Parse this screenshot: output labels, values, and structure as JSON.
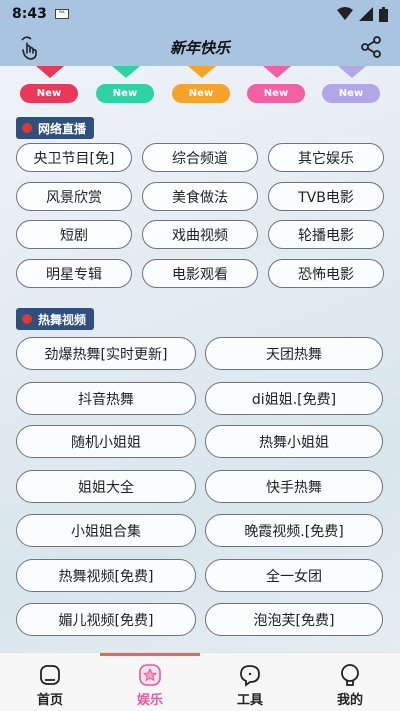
{
  "status": {
    "time": "8:43",
    "mini_icon": "ᴮᴬ"
  },
  "header": {
    "title": "新年快乐"
  },
  "colors": {
    "header": "#a8c4e0",
    "section": "#2f4f7f",
    "accent_pink": "#e05ba0",
    "indicator": "#e3685a"
  },
  "tabs": [
    {
      "label": "New",
      "color": "#e8395b"
    },
    {
      "label": "New",
      "color": "#2ed3a4"
    },
    {
      "label": "New",
      "color": "#f7a229"
    },
    {
      "label": "New",
      "color": "#f25fa2"
    },
    {
      "label": "New",
      "color": "#b3a6e6"
    }
  ],
  "section1": {
    "title": "网络直播",
    "items": [
      "央卫节目[免]",
      "综合频道",
      "其它娱乐",
      "风景欣赏",
      "美食做法",
      "TVB电影",
      "短剧",
      "戏曲视频",
      "轮播电影",
      "明星专辑",
      "电影观看",
      "恐怖电影"
    ]
  },
  "section2": {
    "title": "热舞视频",
    "items": [
      "劲爆热舞[实时更新]",
      "天团热舞",
      "抖音热舞",
      "di姐姐.[免费]",
      "随机小姐姐",
      "热舞小姐姐",
      "姐姐大全",
      "快手热舞",
      "小姐姐合集",
      "晚霞视频.[免费]",
      "热舞视频[免费]",
      "全一女团",
      "媚儿视频[免费]",
      "泡泡芙[免费]"
    ]
  },
  "nav": [
    {
      "label": "首页",
      "icon": "home-icon"
    },
    {
      "label": "娱乐",
      "icon": "star-icon"
    },
    {
      "label": "工具",
      "icon": "tools-icon"
    },
    {
      "label": "我的",
      "icon": "profile-icon"
    }
  ]
}
